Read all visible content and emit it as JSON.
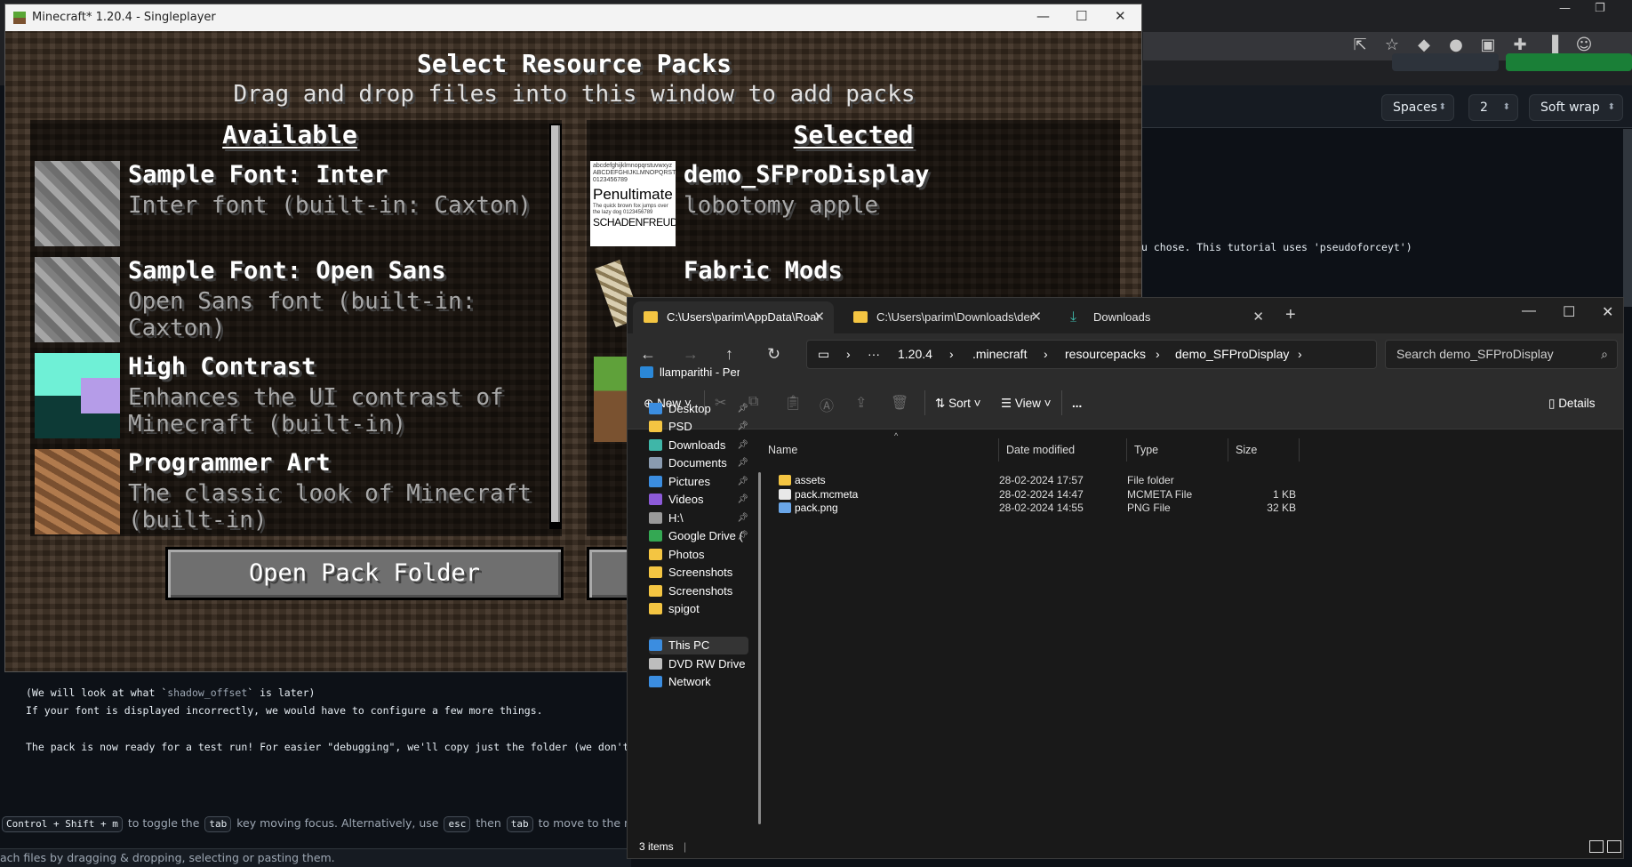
{
  "editor": {
    "spaces": "Spaces",
    "indent": "2",
    "wrap": "Soft wrap",
    "line_fragment": "u chose. This tutorial uses 'pseudoforceyt')"
  },
  "doc": {
    "line1_pre": "(We will look at what `",
    "line1_code": "shadow_offset",
    "line1_post": "` is later)",
    "line2": "If your font is displayed incorrectly, we would have to configure a few more things.",
    "line3": "The pack is now ready for a test run! For easier \"debugging\", we'll copy just the folder (we don't zip",
    "hint": {
      "key1": "Control + Shift + m",
      "t1": "to toggle the",
      "key2": "tab",
      "t2": "key moving focus. Alternatively, use",
      "key3": "esc",
      "t3": "then",
      "key4": "tab",
      "t4": "to move to the next interac"
    },
    "footer": "ach files by dragging & dropping, selecting or pasting them."
  },
  "minecraft": {
    "window_title": "Minecraft* 1.20.4 - Singleplayer",
    "title": "Select Resource Packs",
    "subtitle": "Drag and drop files into this window to add packs",
    "available_heading": "Available",
    "selected_heading": "Selected",
    "available": [
      {
        "name": "Sample Font: Inter",
        "desc": "Inter font (built-in: Caxton)",
        "icon": "stone-block"
      },
      {
        "name": "Sample Font: Open Sans",
        "desc": "Open Sans font (built-in: Caxton)",
        "icon": "stone-block"
      },
      {
        "name": "High Contrast",
        "desc": "Enhances the UI contrast of Minecraft (built-in)",
        "icon": "high-contrast"
      },
      {
        "name": "Programmer Art",
        "desc": "The classic look of Minecraft (built-in)",
        "icon": "dirt-block"
      }
    ],
    "selected": [
      {
        "name": "demo_SFProDisplay",
        "desc": "lobotomy apple",
        "icon": "font-preview",
        "thumb": {
          "l1": "abcdefghijklmnopqrstuvwxyz ABCDEFGHIJKLMNOPQRSTUVWXYZ 0123456789",
          "l2": "Penultimate",
          "l3": "The quick brown fox jumps over the lazy dog 0123456789",
          "l4": "SCHADENFREUDE"
        }
      },
      {
        "name": "Fabric Mods",
        "desc": "",
        "icon": "bone"
      }
    ],
    "open_folder_button": "Open Pack Folder"
  },
  "explorer": {
    "tabs": [
      {
        "label": "C:\\Users\\parim\\AppData\\Roar",
        "active": true
      },
      {
        "label": "C:\\Users\\parim\\Downloads\\der",
        "active": false
      },
      {
        "label": "Downloads",
        "active": false
      }
    ],
    "breadcrumb": [
      "1.20.4",
      ".minecraft",
      "resourcepacks",
      "demo_SFProDisplay"
    ],
    "search_placeholder": "Search demo_SFProDisplay",
    "commands": {
      "new": "New",
      "sort": "Sort",
      "view": "View",
      "more": "...",
      "details": "Details"
    },
    "sidebar": [
      {
        "label": "llamparithi - Perso",
        "icon": "onedrive",
        "color": "#2b88d8",
        "pinned": false
      },
      {
        "label": "Desktop",
        "icon": "desktop",
        "color": "#3b8de0",
        "pinned": true
      },
      {
        "label": "PSD",
        "icon": "folder",
        "color": "#f4c542",
        "pinned": true
      },
      {
        "label": "Downloads",
        "icon": "download",
        "color": "#3fb6a8",
        "pinned": true
      },
      {
        "label": "Documents",
        "icon": "documents",
        "color": "#8a9bb0",
        "pinned": true
      },
      {
        "label": "Pictures",
        "icon": "pictures",
        "color": "#3b8de0",
        "pinned": true
      },
      {
        "label": "Videos",
        "icon": "videos",
        "color": "#8c5ad8",
        "pinned": true
      },
      {
        "label": "H:\\",
        "icon": "drive",
        "color": "#9a9a9a",
        "pinned": true
      },
      {
        "label": "Google Drive (",
        "icon": "google-drive",
        "color": "#34a853",
        "pinned": true
      },
      {
        "label": "Photos",
        "icon": "folder",
        "color": "#f4c542",
        "pinned": false
      },
      {
        "label": "Screenshots",
        "icon": "folder",
        "color": "#f4c542",
        "pinned": false
      },
      {
        "label": "Screenshots",
        "icon": "folder",
        "color": "#f4c542",
        "pinned": false
      },
      {
        "label": "spigot",
        "icon": "folder",
        "color": "#f4c542",
        "pinned": false
      },
      {
        "label": "This PC",
        "icon": "this-pc",
        "color": "#3b8de0",
        "pinned": false,
        "selected": true
      },
      {
        "label": "DVD RW Drive (D:",
        "icon": "dvd",
        "color": "#bdbdbd",
        "pinned": false
      },
      {
        "label": "Network",
        "icon": "network",
        "color": "#3b8de0",
        "pinned": false
      }
    ],
    "columns": [
      "Name",
      "Date modified",
      "Type",
      "Size"
    ],
    "files": [
      {
        "name": "assets",
        "date": "28-02-2024 17:57",
        "type": "File folder",
        "size": "",
        "icon": "folder"
      },
      {
        "name": "pack.mcmeta",
        "date": "28-02-2024 14:47",
        "type": "MCMETA File",
        "size": "1 KB",
        "icon": "file"
      },
      {
        "name": "pack.png",
        "date": "28-02-2024 14:55",
        "type": "PNG File",
        "size": "32 KB",
        "icon": "image-file"
      }
    ],
    "status": "3 items"
  }
}
